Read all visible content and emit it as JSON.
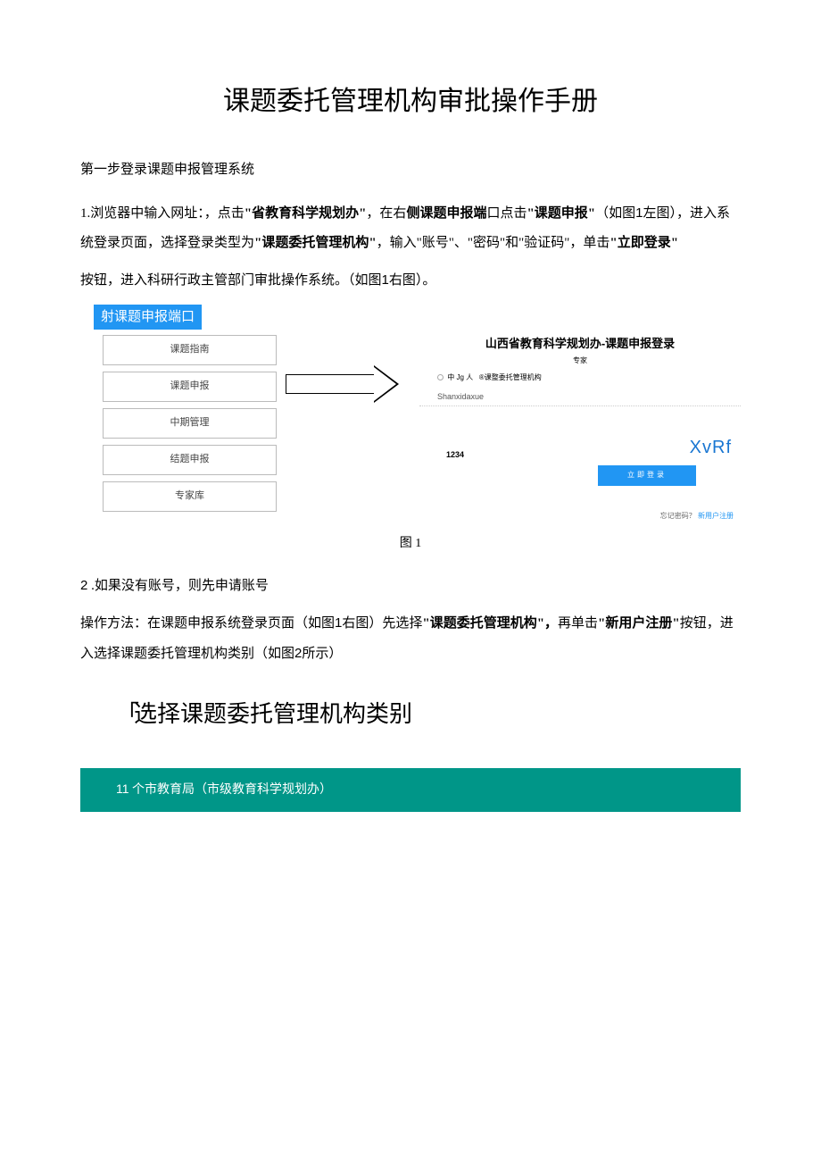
{
  "title": "课题委托管理机构审批操作手册",
  "step1_heading": "第一步登录课题申报管理系统",
  "para1_a": "1.浏览器中输入网址：，点击",
  "para1_b": "\"省教育科学规划办\"",
  "para1_c": "，在右",
  "para1_d": "侧课题申报端",
  "para1_e": "口点击",
  "para1_f": "\"课题申报\"",
  "para1_g": "（如图",
  "para1_h": "1",
  "para1_i": "左图），进入系统登录页面，选择登录类型为",
  "para1_j": "\"课题委托管理机构\"",
  "para1_k": "，输入\"账号\"、\"密码\"和\"验证码\"，单击",
  "para1_l": "\"立即登录\"",
  "para2_a": "按钮，进入科研行政主管部门审批操作系统。（如图",
  "para2_b": "1",
  "para2_c": "右图）。",
  "port_label": "射课题申报端口",
  "menu": [
    "课题指南",
    "课题申报",
    "中期管理",
    "结题申报",
    "专家库"
  ],
  "login_title": "山西省教育科学规划办-课题申报登录",
  "login_sub": "专家",
  "radio_a": "中 Jg 人",
  "radio_b": "®课整委托管理机构",
  "username": "Shanxidaxue",
  "captcha_input": "1234",
  "captcha_display": "XvRf",
  "login_btn": "立即登录",
  "forgot_a": "忘记密码？",
  "forgot_b": "新用户注册",
  "fig1_caption": "图 1",
  "para3_a": "2",
  "para3_b": " .如果没有账号，则先申请账号",
  "para4_a": "操作方法：在课题申报系统登录页面（如图",
  "para4_b": "1",
  "para4_c": "右图）先选择",
  "para4_d": "\"课题委托管理机构\"，",
  "para4_e": "再单击",
  "para4_f": "\"新用户注册\"",
  "para4_g": "按钮，进入选择课题委托管理机构类别（如图",
  "para4_h": "2",
  "para4_i": "所示）",
  "sub_heading_prefix": "「",
  "sub_heading": "选择课题委托管理机构类别",
  "teal_a": "11",
  "teal_b": " 个市教育局（市级教育科学规划办）"
}
